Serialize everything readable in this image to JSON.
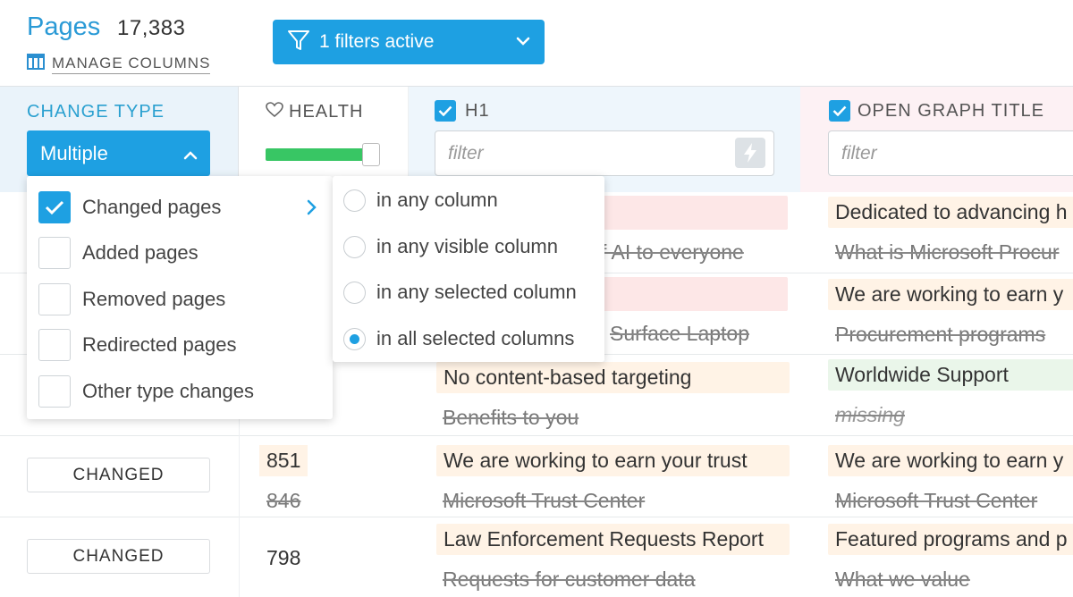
{
  "header": {
    "title": "Pages",
    "count": "17,383",
    "manage_columns": "MANAGE COLUMNS",
    "filter_button": "1 filters active"
  },
  "columns": {
    "change_type": {
      "title": "CHANGE TYPE",
      "selected": "Multiple"
    },
    "health": {
      "title": "HEALTH",
      "slider_value_fraction": 0.95
    },
    "h1": {
      "title": "H1",
      "checked": true,
      "filter_placeholder": "filter"
    },
    "og_title": {
      "title": "OPEN GRAPH TITLE",
      "checked": true,
      "filter_placeholder": "filter"
    }
  },
  "change_type_menu": [
    {
      "label": "Changed pages",
      "checked": true
    },
    {
      "label": "Added pages",
      "checked": false
    },
    {
      "label": "Removed pages",
      "checked": false
    },
    {
      "label": "Redirected pages",
      "checked": false
    },
    {
      "label": "Other type changes",
      "checked": false
    }
  ],
  "match_submenu": [
    {
      "label": "in any column",
      "selected": false
    },
    {
      "label": "in any visible column",
      "selected": false
    },
    {
      "label": "in any selected column",
      "selected": false
    },
    {
      "label": "in all selected columns",
      "selected": true
    }
  ],
  "rows": [
    {
      "h1_old_partial": "f AI to everyone",
      "og_new": "Dedicated to advancing h",
      "og_old": "What is Microsoft Procur"
    },
    {
      "h1_old_partial": "Surface Laptop",
      "og_new": "We are working to earn y",
      "og_old": "Procurement programs"
    },
    {
      "h1_new": "No content-based targeting",
      "h1_old": "Benefits to you",
      "og_new": "Worldwide Support",
      "og_old": "missing"
    },
    {
      "change_type": "CHANGED",
      "health_new": "851",
      "health_old": "846",
      "h1_new": "We are working to earn your trust",
      "h1_old": "Microsoft Trust Center",
      "og_new": "We are working to earn y",
      "og_old": "Microsoft Trust Center"
    },
    {
      "change_type": "CHANGED",
      "health": "798",
      "h1_new": "Law Enforcement Requests Report",
      "h1_old": "Requests for customer data",
      "og_new": "Featured programs and p",
      "og_old": "What we value"
    }
  ],
  "colors": {
    "accent": "#1ea0e2",
    "health_bar": "#38c664",
    "highlight_removed": "#fde7e7",
    "highlight_changed": "#fff3e6",
    "highlight_added": "#eaf6ea"
  }
}
